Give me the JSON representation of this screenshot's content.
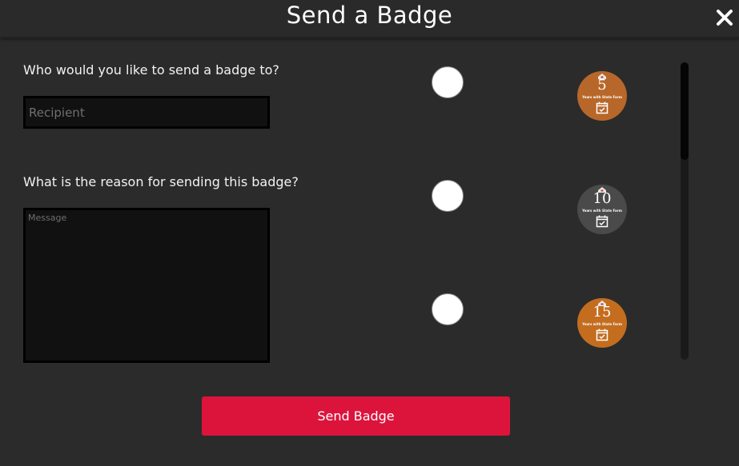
{
  "dialog": {
    "title": "Send a Badge",
    "close_icon": "close-x-icon"
  },
  "form": {
    "recipient_label": "Who would you like to send a badge to?",
    "recipient_placeholder": "Recipient",
    "recipient_value": "",
    "reason_label": "What is the reason for sending this badge?",
    "message_placeholder": "Message",
    "message_value": ""
  },
  "badges": [
    {
      "number": "5",
      "caption": "Years with State Farm",
      "color": "#b8672a",
      "selected": false
    },
    {
      "number": "10",
      "caption": "Years with State Farm",
      "color": "#4a4a4a",
      "selected": false
    },
    {
      "number": "15",
      "caption": "Years with State Farm",
      "color": "#c46d1f",
      "selected": false
    }
  ],
  "actions": {
    "send_label": "Send Badge"
  },
  "colors": {
    "accent": "#dc143c",
    "background": "#2b2b2b",
    "input_background": "#111111"
  }
}
